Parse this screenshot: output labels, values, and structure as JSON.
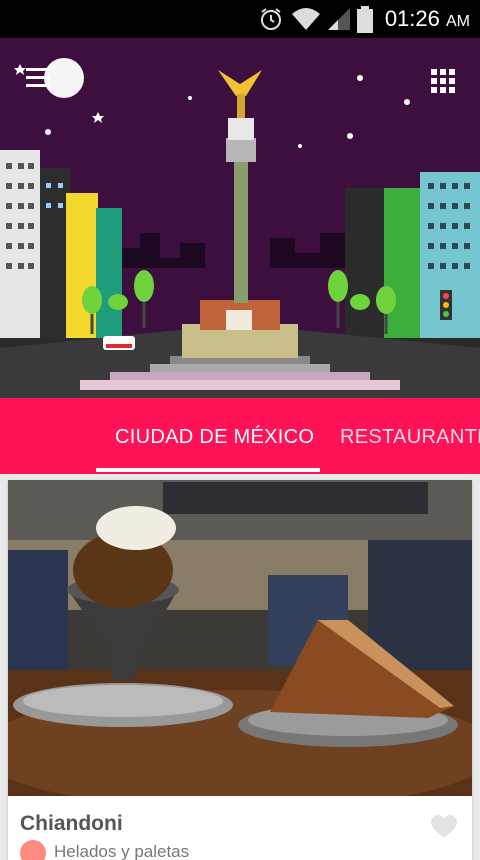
{
  "status_bar": {
    "time": "01:26",
    "ampm": "AM",
    "icons": [
      "alarm-icon",
      "wifi-icon",
      "signal-icon",
      "battery-icon"
    ]
  },
  "header": {
    "menu_icon": "menu-icon",
    "grid_icon": "grid-icon",
    "illustration": "angel-de-la-independencia-night-city"
  },
  "tabs": [
    {
      "label": "CIUDAD DE MÉXICO",
      "selected": true
    },
    {
      "label": "RESTAURANTES",
      "selected": false
    }
  ],
  "colors": {
    "accent": "#ff1256",
    "sky": "#3d0f3f",
    "status_bar": "#000000"
  },
  "card": {
    "title": "Chiandoni",
    "category": "Helados y paletas",
    "favorite_icon": "heart-icon"
  }
}
